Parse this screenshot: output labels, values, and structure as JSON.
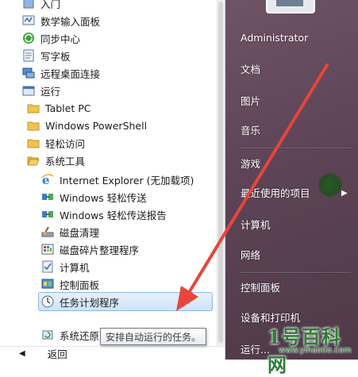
{
  "program_list": [
    {
      "label": "入门",
      "icon": "getting-started-icon",
      "indent": 0
    },
    {
      "label": "数学输入面板",
      "icon": "math-input-panel-icon",
      "indent": 0
    },
    {
      "label": "同步中心",
      "icon": "sync-center-icon",
      "indent": 0
    },
    {
      "label": "写字板",
      "icon": "wordpad-icon",
      "indent": 0
    },
    {
      "label": "远程桌面连接",
      "icon": "remote-desktop-icon",
      "indent": 0
    },
    {
      "label": "运行",
      "icon": "run-icon",
      "indent": 0
    },
    {
      "label": "Tablet PC",
      "icon": "folder-icon",
      "indent": 0
    },
    {
      "label": "Windows PowerShell",
      "icon": "folder-icon",
      "indent": 0
    },
    {
      "label": "轻松访问",
      "icon": "folder-icon",
      "indent": 0
    },
    {
      "label": "系统工具",
      "icon": "folder-icon",
      "indent": 0
    },
    {
      "label": "Internet Explorer (无加载项)",
      "icon": "internet-explorer-icon",
      "indent": 1
    },
    {
      "label": "Windows 轻松传送",
      "icon": "easy-transfer-icon",
      "indent": 1
    },
    {
      "label": "Windows 轻松传送报告",
      "icon": "easy-transfer-report-icon",
      "indent": 1
    },
    {
      "label": "磁盘清理",
      "icon": "disk-cleanup-icon",
      "indent": 1
    },
    {
      "label": "磁盘碎片整理程序",
      "icon": "disk-defragmenter-icon",
      "indent": 1
    },
    {
      "label": "计算机",
      "icon": "computer-icon",
      "indent": 1
    },
    {
      "label": "控制面板",
      "icon": "control-panel-icon",
      "indent": 1
    },
    {
      "label": "任务计划程序",
      "icon": "task-scheduler-icon",
      "indent": 1,
      "selected": true
    },
    {
      "label": "系统还原",
      "icon": "system-restore-icon",
      "indent": 1
    }
  ],
  "back_label": "返回",
  "tooltip": "安排自动运行的任务。",
  "right_menu": [
    {
      "label": "Administrator",
      "name": "user-name"
    },
    {
      "label": "文档",
      "name": "documents"
    },
    {
      "label": "图片",
      "name": "pictures"
    },
    {
      "label": "音乐",
      "name": "music"
    },
    {
      "label": "游戏",
      "name": "games"
    },
    {
      "label": "最近使用的项目",
      "name": "recent-items"
    },
    {
      "label": "计算机",
      "name": "computer"
    },
    {
      "label": "网络",
      "name": "network"
    },
    {
      "label": "控制面板",
      "name": "control-panel"
    },
    {
      "label": "设备和打印机",
      "name": "devices-printers"
    },
    {
      "label": "运行...",
      "name": "run"
    }
  ],
  "watermark": {
    "title": "1号百科网",
    "url": "www.yihaotie.com"
  },
  "colors": {
    "right_pane": "#5d4456",
    "annotation_arrow": "#e8453c",
    "selection": "#cfe3f9"
  }
}
